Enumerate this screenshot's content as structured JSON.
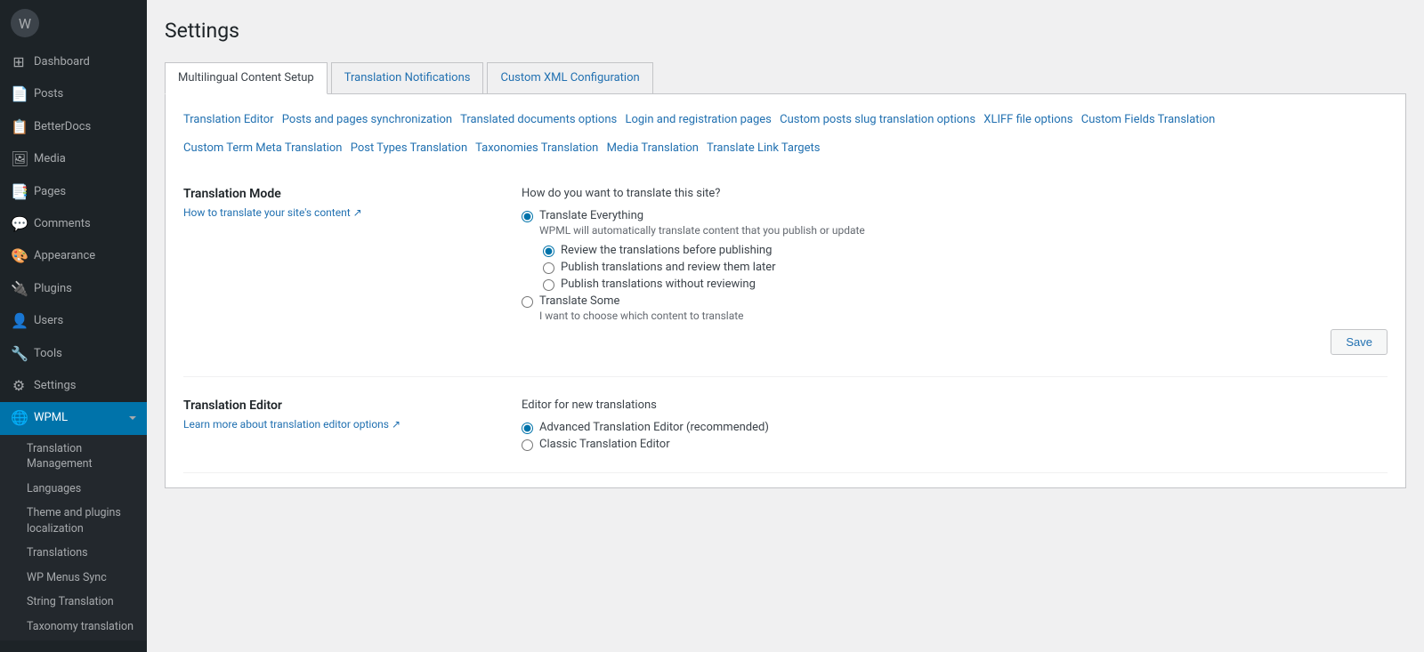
{
  "sidebar": {
    "logo_icon": "⊞",
    "items": [
      {
        "id": "dashboard",
        "label": "Dashboard",
        "icon": "⊞",
        "active": false
      },
      {
        "id": "posts",
        "label": "Posts",
        "icon": "📄",
        "active": false
      },
      {
        "id": "betterdocs",
        "label": "BetterDocs",
        "icon": "📋",
        "active": false
      },
      {
        "id": "media",
        "label": "Media",
        "icon": "🖼",
        "active": false
      },
      {
        "id": "pages",
        "label": "Pages",
        "icon": "📑",
        "active": false
      },
      {
        "id": "comments",
        "label": "Comments",
        "icon": "💬",
        "active": false
      },
      {
        "id": "appearance",
        "label": "Appearance",
        "icon": "🎨",
        "active": false
      },
      {
        "id": "plugins",
        "label": "Plugins",
        "icon": "🔌",
        "active": false
      },
      {
        "id": "users",
        "label": "Users",
        "icon": "👤",
        "active": false
      },
      {
        "id": "tools",
        "label": "Tools",
        "icon": "🔧",
        "active": false
      },
      {
        "id": "settings",
        "label": "Settings",
        "icon": "⚙",
        "active": false
      },
      {
        "id": "wpml",
        "label": "WPML",
        "icon": "🌐",
        "active": true
      }
    ],
    "sub_items": [
      {
        "id": "translation-management",
        "label": "Translation Management",
        "active": false
      },
      {
        "id": "languages",
        "label": "Languages",
        "active": false
      },
      {
        "id": "theme-plugins",
        "label": "Theme and plugins localization",
        "active": false
      },
      {
        "id": "translations",
        "label": "Translations",
        "active": false
      },
      {
        "id": "wp-menus-sync",
        "label": "WP Menus Sync",
        "active": false
      },
      {
        "id": "string-translation",
        "label": "String Translation",
        "active": false
      },
      {
        "id": "taxonomy-translation",
        "label": "Taxonomy translation",
        "active": false
      }
    ]
  },
  "page_title": "Settings",
  "tabs": [
    {
      "id": "multilingual",
      "label": "Multilingual Content Setup",
      "active": true
    },
    {
      "id": "notifications",
      "label": "Translation Notifications",
      "active": false
    },
    {
      "id": "xml",
      "label": "Custom XML Configuration",
      "active": false
    }
  ],
  "links": [
    "Translation Editor",
    "Posts and pages synchronization",
    "Translated documents options",
    "Login and registration pages",
    "Custom posts slug translation options",
    "XLIFF file options",
    "Custom Fields Translation"
  ],
  "links2": [
    "Custom Term Meta Translation",
    "Post Types Translation",
    "Taxonomies Translation",
    "Media Translation",
    "Translate Link Targets"
  ],
  "translation_mode": {
    "section_title": "Translation Mode",
    "section_link": "How to translate your site's content",
    "section_link_icon": "↗",
    "question": "How do you want to translate this site?",
    "option_everything_label": "Translate Everything",
    "option_everything_desc": "WPML will automatically translate content that you publish or update",
    "option_everything_selected": true,
    "sub_options": [
      {
        "id": "review-before",
        "label": "Review the translations before publishing",
        "selected": true
      },
      {
        "id": "publish-review-later",
        "label": "Publish translations and review them later",
        "selected": false
      },
      {
        "id": "publish-no-review",
        "label": "Publish translations without reviewing",
        "selected": false
      }
    ],
    "option_some_label": "Translate Some",
    "option_some_desc": "I want to choose which content to translate",
    "option_some_selected": false,
    "save_button": "Save"
  },
  "translation_editor": {
    "section_title": "Translation Editor",
    "section_link": "Learn more about translation editor options",
    "section_link_icon": "↗",
    "question": "Editor for new translations",
    "sub_options": [
      {
        "id": "advanced",
        "label": "Advanced Translation Editor (recommended)",
        "selected": true
      },
      {
        "id": "classic",
        "label": "Classic Translation Editor",
        "selected": false
      }
    ]
  }
}
